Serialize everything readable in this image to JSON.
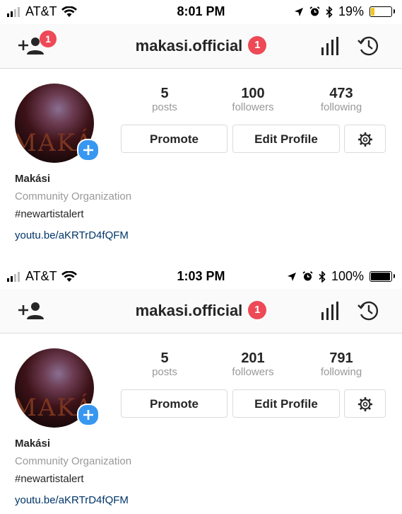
{
  "screenshots": [
    {
      "status": {
        "carrier": "AT&T",
        "time": "8:01 PM",
        "battery": "19%",
        "battery_level": 0.19,
        "battery_color": "#f5c518"
      },
      "header": {
        "username": "makasi.official",
        "notification_count": "1",
        "add_user_badge": "1"
      },
      "stats": {
        "posts": {
          "value": "5",
          "label": "posts"
        },
        "followers": {
          "value": "100",
          "label": "followers"
        },
        "following": {
          "value": "473",
          "label": "following"
        }
      },
      "buttons": {
        "promote": "Promote",
        "edit_profile": "Edit Profile"
      },
      "profile": {
        "name": "Makási",
        "category": "Community Organization",
        "bio": "#newartistalert",
        "link": "youtu.be/aKRTrD4fQFM",
        "avatar_text": "MAKÁS"
      }
    },
    {
      "status": {
        "carrier": "AT&T",
        "time": "1:03 PM",
        "battery": "100%",
        "battery_level": 1.0,
        "battery_color": "#000000"
      },
      "header": {
        "username": "makasi.official",
        "notification_count": "1"
      },
      "stats": {
        "posts": {
          "value": "5",
          "label": "posts"
        },
        "followers": {
          "value": "201",
          "label": "followers"
        },
        "following": {
          "value": "791",
          "label": "following"
        }
      },
      "buttons": {
        "promote": "Promote",
        "edit_profile": "Edit Profile"
      },
      "profile": {
        "name": "Makási",
        "category": "Community Organization",
        "bio": "#newartistalert",
        "link": "youtu.be/aKRTrD4fQFM",
        "avatar_text": "MAKÁS"
      }
    }
  ],
  "colors": {
    "accent_blue": "#3897f0",
    "badge_red": "#ed4956",
    "link": "#003569",
    "muted": "#999999"
  },
  "icons": [
    "signal-icon",
    "wifi-icon",
    "location-arrow-icon",
    "alarm-icon",
    "bluetooth-icon",
    "battery-icon",
    "add-user-icon",
    "insights-icon",
    "archive-icon",
    "plus-icon",
    "gear-icon"
  ]
}
